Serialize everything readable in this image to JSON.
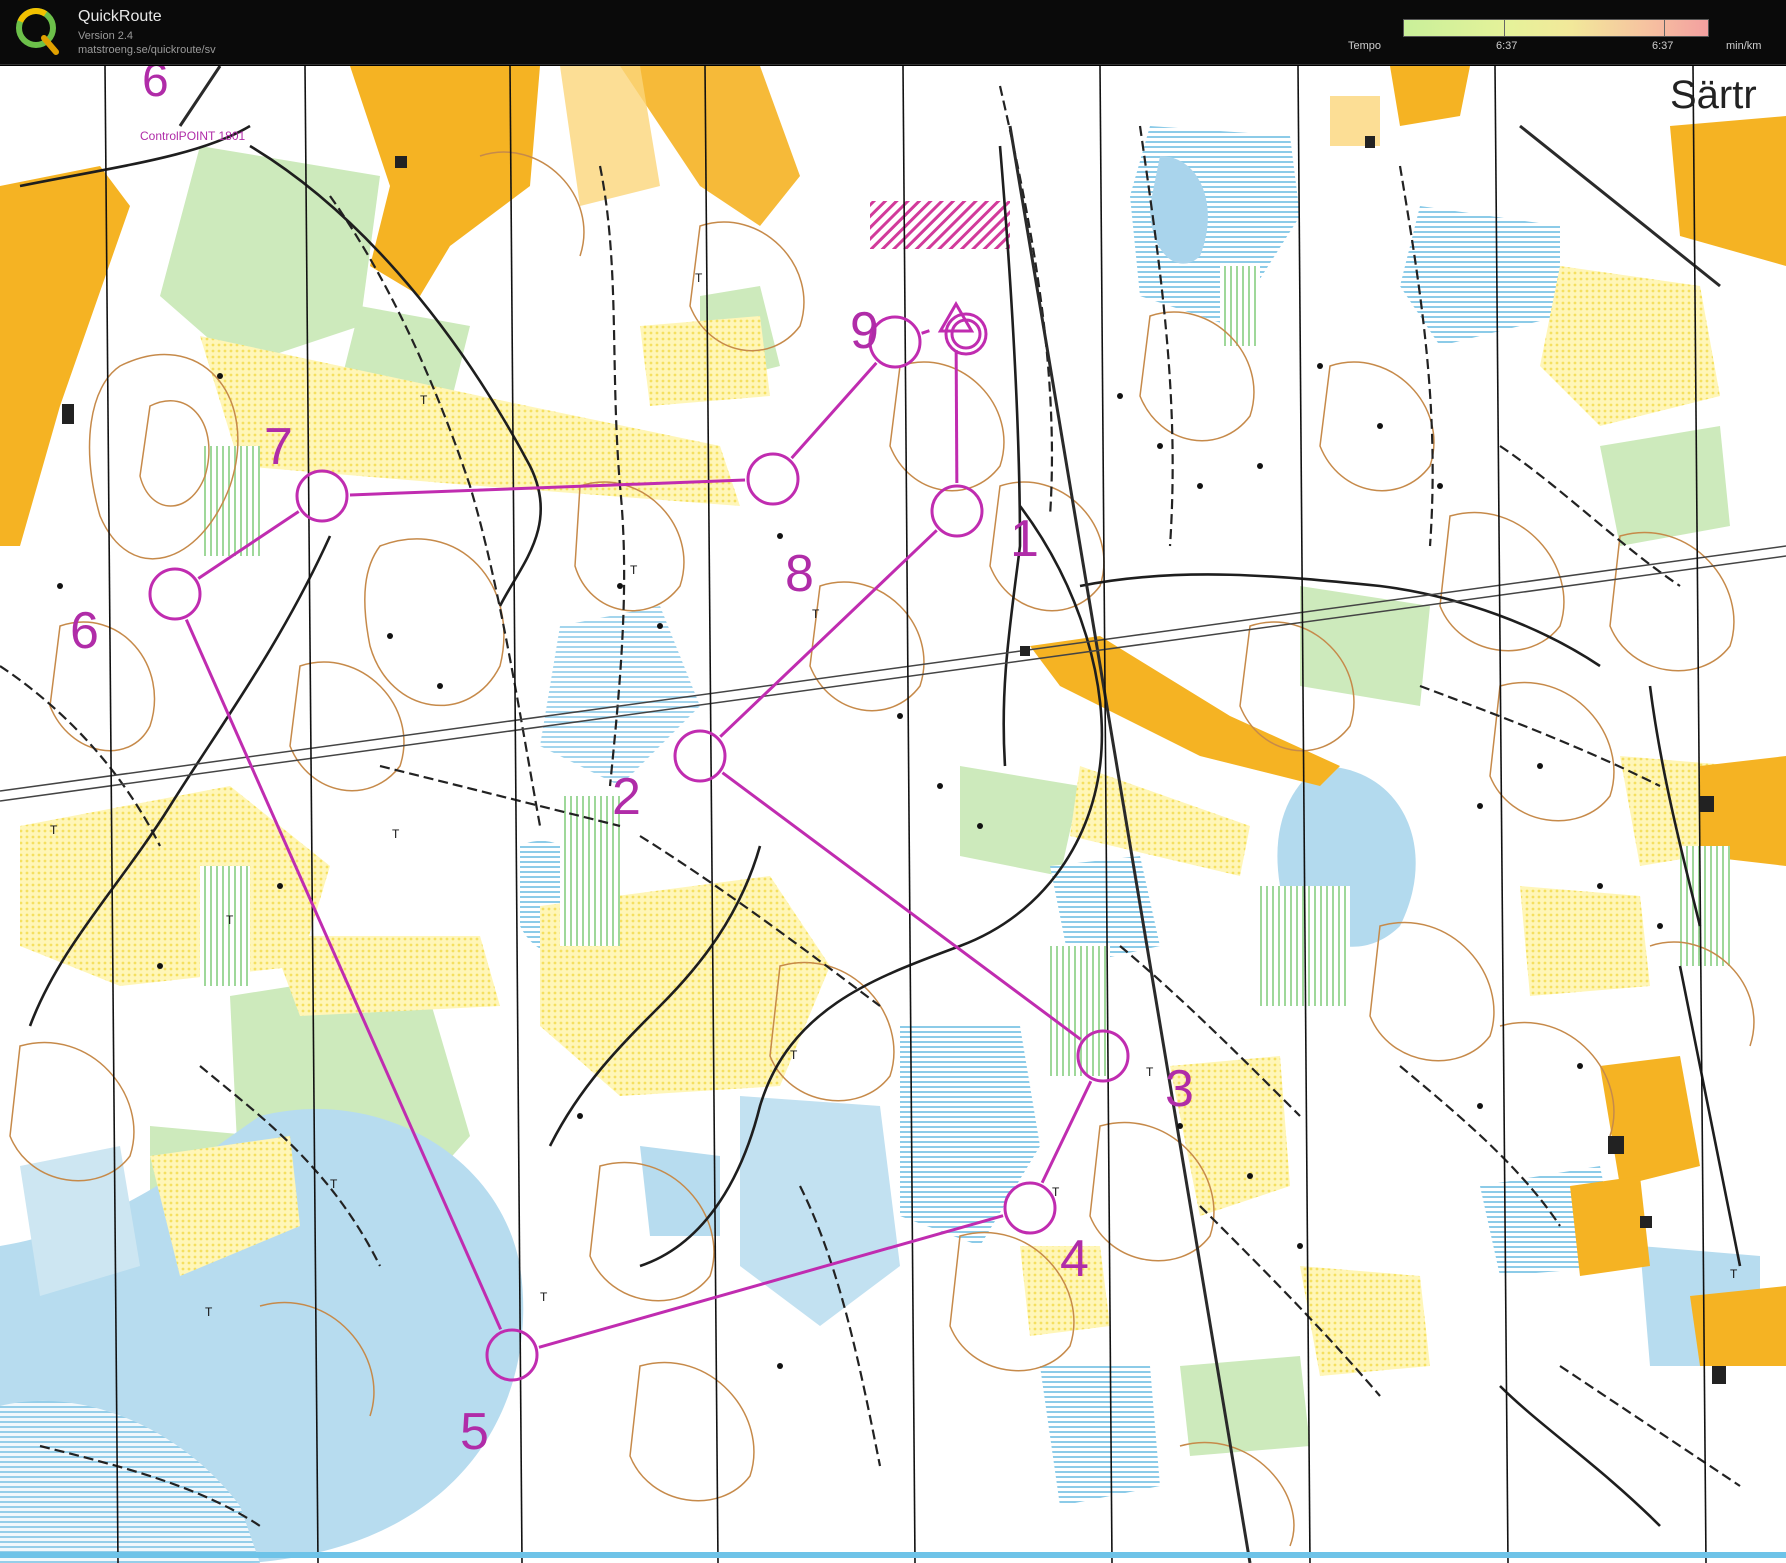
{
  "app": {
    "name": "QuickRoute",
    "version": "Version 2.4",
    "url": "matstroeng.se/quickroute/sv"
  },
  "legend": {
    "label": "Tempo",
    "left_value": "6:37",
    "right_value": "6:37",
    "unit": "min/km"
  },
  "map": {
    "place_name": "Särtr",
    "control_box_text": "ControlPOINT 1801",
    "corner_label": "6",
    "colors": {
      "course": "#c02cb0",
      "yellow": "#fff19a",
      "orange": "#f5b323",
      "green": "#c9e8b8",
      "blue": "#b5dcf0",
      "contour": "#c68a4a"
    },
    "controls": [
      {
        "id": "start",
        "label": ""
      },
      {
        "id": "c1",
        "label": "1"
      },
      {
        "id": "c2",
        "label": "2"
      },
      {
        "id": "c3",
        "label": "3"
      },
      {
        "id": "c4",
        "label": "4"
      },
      {
        "id": "c5",
        "label": "5"
      },
      {
        "id": "c6",
        "label": "6"
      },
      {
        "id": "c7",
        "label": "7"
      },
      {
        "id": "c8",
        "label": "8"
      },
      {
        "id": "c9",
        "label": "9"
      },
      {
        "id": "finish",
        "label": ""
      }
    ],
    "tree_marker": "T"
  }
}
